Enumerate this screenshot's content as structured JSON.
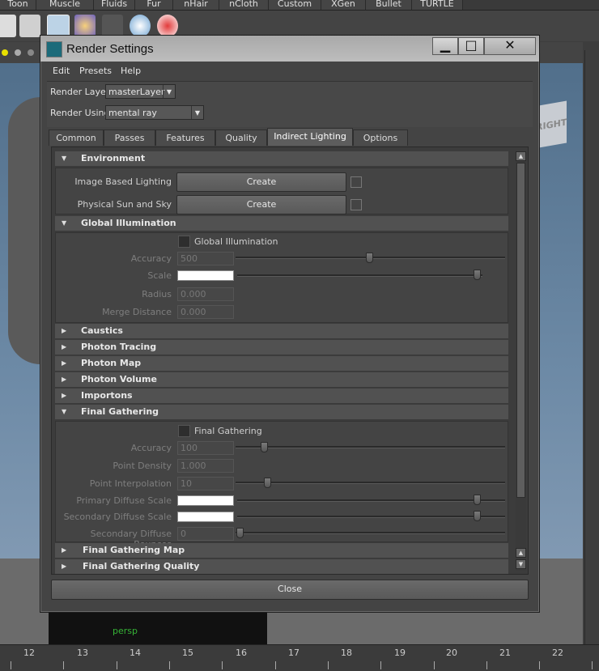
{
  "shelf": {
    "tabs": [
      "Toon",
      "Muscle",
      "Fluids",
      "Fur",
      "nHair",
      "nCloth",
      "Custom",
      "XGen",
      "Bullet",
      "TURTLE"
    ]
  },
  "viewport": {
    "camera_label": "persp",
    "view_cube_label": "RIGHT"
  },
  "timeline": {
    "ticks": [
      "12",
      "13",
      "14",
      "15",
      "16",
      "17",
      "18",
      "19",
      "20",
      "21",
      "22"
    ]
  },
  "window": {
    "title": "Render Settings",
    "minimize": "▁",
    "maximize": "□",
    "close": "✕",
    "menu": [
      "Edit",
      "Presets",
      "Help"
    ],
    "render_layer_label": "Render Layer",
    "render_layer_value": "masterLayer",
    "render_using_label": "Render Using",
    "render_using_value": "mental ray",
    "tabs": [
      "Common",
      "Passes",
      "Features",
      "Quality",
      "Indirect Lighting",
      "Options"
    ],
    "active_tab": "Indirect Lighting",
    "close_button": "Close"
  },
  "environment": {
    "title": "Environment",
    "ibl_label": "Image Based Lighting",
    "ibl_button": "Create",
    "sun_label": "Physical Sun and Sky",
    "sun_button": "Create"
  },
  "global_illumination": {
    "title": "Global Illumination",
    "checkbox_label": "Global Illumination",
    "accuracy_label": "Accuracy",
    "accuracy_value": "500",
    "scale_label": "Scale",
    "radius_label": "Radius",
    "radius_value": "0.000",
    "merge_label": "Merge Distance",
    "merge_value": "0.000"
  },
  "collapsed_sections": [
    "Caustics",
    "Photon Tracing",
    "Photon Map",
    "Photon Volume",
    "Importons"
  ],
  "final_gathering": {
    "title": "Final Gathering",
    "checkbox_label": "Final Gathering",
    "accuracy_label": "Accuracy",
    "accuracy_value": "100",
    "point_density_label": "Point Density",
    "point_density_value": "1.000",
    "point_interp_label": "Point Interpolation",
    "point_interp_value": "10",
    "primary_label": "Primary Diffuse Scale",
    "secondary_label": "Secondary Diffuse Scale",
    "bounces_label": "Secondary Diffuse Bounces",
    "bounces_value": "0"
  },
  "trailing_sections": [
    "Final Gathering Map",
    "Final Gathering Quality"
  ],
  "colors": {
    "swatch": "#ffffff",
    "camera_label": "#36b336"
  }
}
